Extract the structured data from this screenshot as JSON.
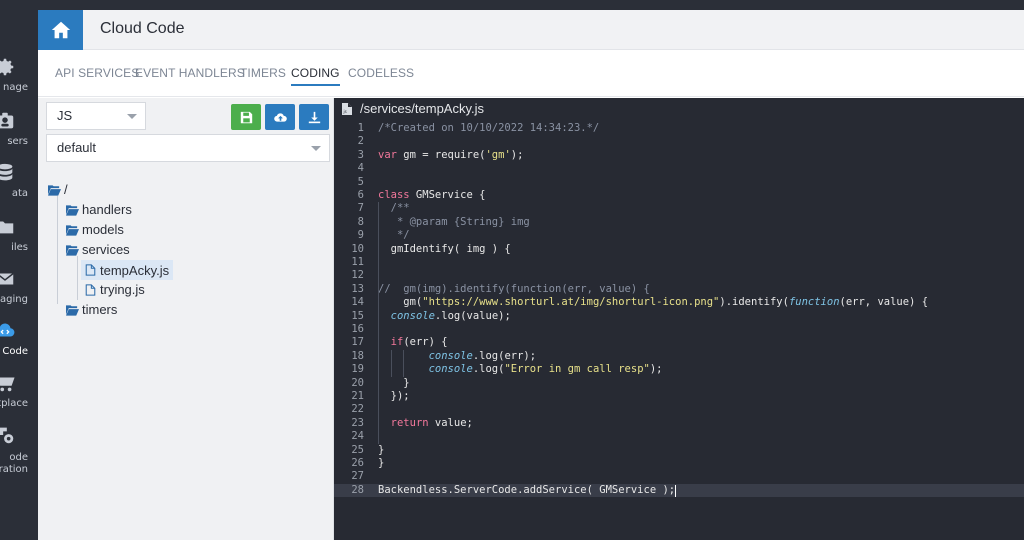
{
  "header": {
    "title": "Cloud Code"
  },
  "rail": {
    "items": [
      {
        "label": "nage",
        "icon": "gear-icon"
      },
      {
        "label": "sers",
        "icon": "users-icon"
      },
      {
        "label": "ata",
        "icon": "database-icon"
      },
      {
        "label": "iles",
        "icon": "folder-icon"
      },
      {
        "label": "saging",
        "icon": "mail-icon"
      },
      {
        "label": "d Code",
        "icon": "cloud-code-icon"
      },
      {
        "label": "etplace",
        "icon": "cart-icon"
      },
      {
        "label1": "ode",
        "label2": "eration",
        "icon": "code-generation-icon"
      }
    ]
  },
  "tabs": [
    {
      "label": "API SERVICES"
    },
    {
      "label": "EVENT HANDLERS"
    },
    {
      "label": "TIMERS"
    },
    {
      "label": "CODING"
    },
    {
      "label": "CODELESS"
    }
  ],
  "left_panel": {
    "language_select": "JS",
    "model_select": "default",
    "save_icon": "save-icon",
    "deploy_icon": "cloud-upload-icon",
    "download_icon": "download-icon",
    "save_color": "#4cae4c",
    "deploy_color": "#2b7bbf",
    "download_color": "#2b7bbf",
    "tree": {
      "root": "/",
      "folders": [
        "handlers",
        "models",
        "services",
        "timers"
      ],
      "services_files": [
        "tempAcky.js",
        "trying.js"
      ]
    }
  },
  "editor": {
    "file_path": "/services/tempAcky.js",
    "lines": [
      {
        "n": "1",
        "text": "/*Created on 10/10/2022 14:34:23.*/"
      },
      {
        "n": "2",
        "text": ""
      },
      {
        "n": "3",
        "text": "var gm = require('gm');"
      },
      {
        "n": "4",
        "text": ""
      },
      {
        "n": "5",
        "text": ""
      },
      {
        "n": "6",
        "text": "class GMService {"
      },
      {
        "n": "7",
        "text": "  /**"
      },
      {
        "n": "8",
        "text": "   * @param {String} img"
      },
      {
        "n": "9",
        "text": "   */"
      },
      {
        "n": "10",
        "text": "  gmIdentify( img ) {"
      },
      {
        "n": "11",
        "text": ""
      },
      {
        "n": "12",
        "text": ""
      },
      {
        "n": "13",
        "text": "//  gm(img).identify(function(err, value) {"
      },
      {
        "n": "14",
        "text": "    gm(\"https://www.shorturl.at/img/shorturl-icon.png\").identify(function(err, value) {"
      },
      {
        "n": "15",
        "text": "  console.log(value);"
      },
      {
        "n": "16",
        "text": ""
      },
      {
        "n": "17",
        "text": "  if(err) {"
      },
      {
        "n": "18",
        "text": "        console.log(err);"
      },
      {
        "n": "19",
        "text": "        console.log(\"Error in gm call resp\");"
      },
      {
        "n": "20",
        "text": "    }"
      },
      {
        "n": "21",
        "text": "  });"
      },
      {
        "n": "22",
        "text": ""
      },
      {
        "n": "23",
        "text": "  return value;"
      },
      {
        "n": "24",
        "text": ""
      },
      {
        "n": "25",
        "text": "}"
      },
      {
        "n": "26",
        "text": "}"
      },
      {
        "n": "27",
        "text": ""
      },
      {
        "n": "28",
        "text": "Backendless.ServerCode.addService( GMService );"
      }
    ],
    "current_line": "28"
  },
  "colors": {
    "accent": "#2b7bbf",
    "editor_bg": "#272a33",
    "keyword": "#f2779b",
    "string": "#e7e08a",
    "comment": "#8a92a3"
  }
}
